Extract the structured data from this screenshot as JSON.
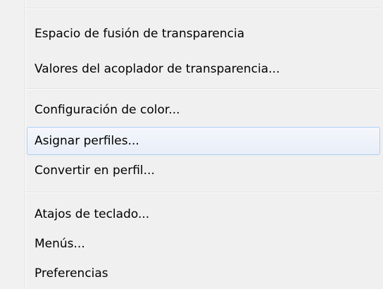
{
  "menu": {
    "items": [
      {
        "label": "Espacio de fusión de transparencia",
        "highlighted": false
      },
      {
        "label": "Valores del acoplador de transparencia...",
        "highlighted": false
      },
      {
        "label": "Configuración de color...",
        "highlighted": false
      },
      {
        "label": "Asignar perfiles...",
        "highlighted": true
      },
      {
        "label": "Convertir en perfil...",
        "highlighted": false
      },
      {
        "label": "Atajos de teclado...",
        "highlighted": false
      },
      {
        "label": "Menús...",
        "highlighted": false
      },
      {
        "label": "Preferencias",
        "highlighted": false
      }
    ]
  },
  "colors": {
    "menu_background": "#f0f0f0",
    "highlight_border": "#aecff7",
    "highlight_fill": "#e8eef8",
    "separator": "#e0e0e0",
    "text": "#000000"
  }
}
